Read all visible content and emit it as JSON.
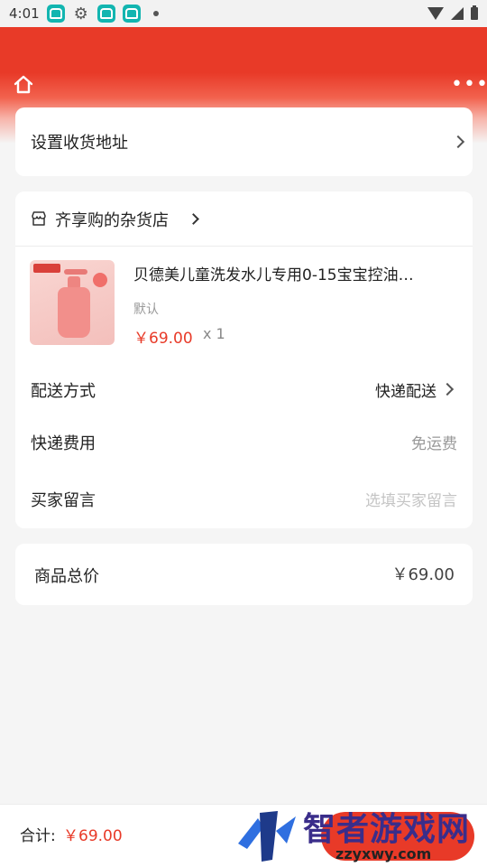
{
  "status_bar": {
    "time": "4:01"
  },
  "order": {
    "address": {
      "label": "设置收货地址"
    },
    "shop": {
      "name": "齐享购的杂货店"
    },
    "product": {
      "title": "贝德美儿童洗发水儿专用0-15宝宝控油…",
      "spec": "默认",
      "price": "￥69.00",
      "qty": "x 1"
    },
    "delivery": {
      "label": "配送方式",
      "value": "快递配送"
    },
    "shipping_fee": {
      "label": "快递费用",
      "value": "免运费"
    },
    "message": {
      "label": "买家留言",
      "placeholder": "选填买家留言"
    }
  },
  "summary": {
    "label": "商品总价",
    "value": "￥69.00"
  },
  "footer": {
    "total_label": "合计:",
    "total_value": "￥69.00"
  },
  "watermark": {
    "brand": "智者游戏网",
    "url": "zzyxwy.com"
  },
  "colors": {
    "accent": "#e83a28",
    "background": "#f5f5f5"
  }
}
